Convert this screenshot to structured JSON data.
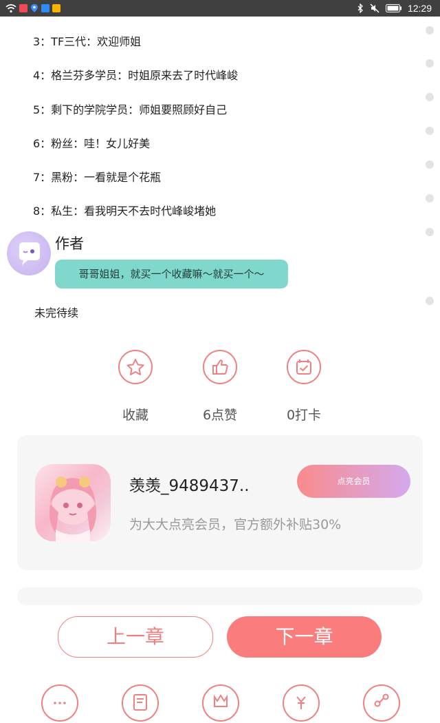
{
  "status_bar": {
    "time": "12:29",
    "left_icons": [
      "wifi-icon",
      "app-icon-red",
      "location-icon",
      "app-icon-blue",
      "app-icon-yellow"
    ],
    "right_icons": [
      "bluetooth-icon",
      "mute-icon",
      "battery-icon"
    ]
  },
  "story_lines": [
    "3：TF三代：欢迎师姐",
    "4：格兰芬多学员：时姐原来去了时代峰峻",
    "5：剩下的学院学员：师姐要照顾好自己",
    "6：粉丝：哇！女儿好美",
    "7：黑粉：一看就是个花瓶",
    "8：私生：看我明天不去时代峰峻堵她"
  ],
  "author": {
    "name": "作者",
    "message": "哥哥姐姐，就买一个收藏嘛～就买一个～"
  },
  "continue_text": "未完待续",
  "actions": [
    {
      "icon": "star-icon",
      "label": "收藏"
    },
    {
      "icon": "thumbs-up-icon",
      "label": "6点赞"
    },
    {
      "icon": "calendar-check-icon",
      "label": "0打卡"
    }
  ],
  "vip": {
    "username": "羡羡_9489437..",
    "subtitle": "为大大点亮会员，官方额外补贴30%",
    "button": "点亮会员"
  },
  "nav": {
    "prev": "上一章",
    "next": "下一章"
  },
  "bottom_icons": [
    "comment-icon",
    "directory-icon",
    "gift-icon",
    "reward-icon",
    "share-icon"
  ],
  "colors": {
    "accent": "#fa7c7c",
    "bubble": "#80d7cc",
    "status_bar": "#404040"
  }
}
